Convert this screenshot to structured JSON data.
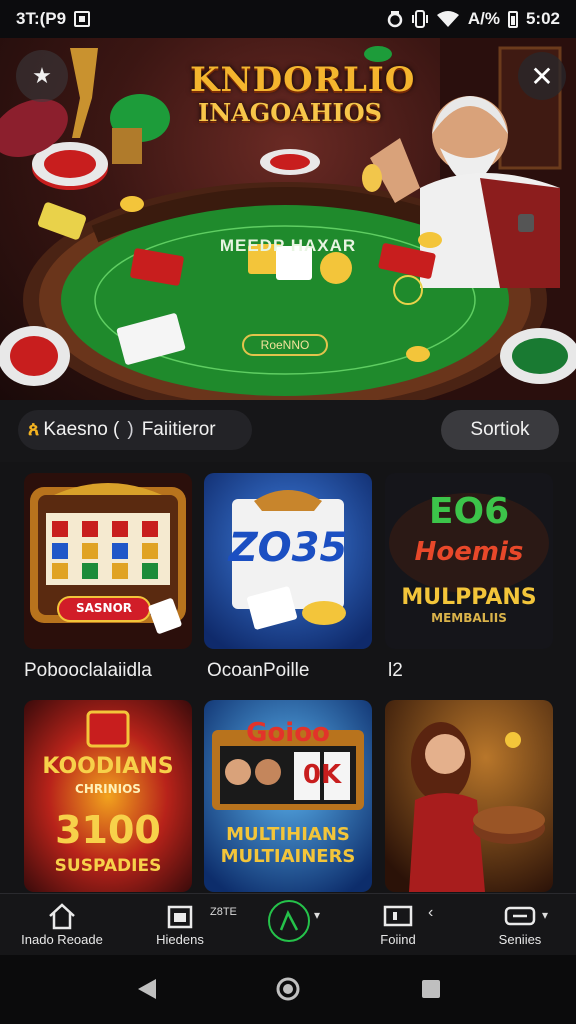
{
  "status_bar": {
    "time_left": "3T:(P9",
    "battery_text": "A/%",
    "clock": "5:02"
  },
  "hero": {
    "title_line1": "KNDORLIO",
    "title_line2": "INAGOAHIOS",
    "table_label": "MEEDP HAXAR",
    "table_button": "RoeNNO",
    "close_icon": "close-icon"
  },
  "filter": {
    "logo_glyph": "ጰ",
    "search_label": "Kaesno (",
    "search_sep": ")",
    "filter_label": "Faiitieror",
    "sort_label": "Sortiok"
  },
  "games": [
    {
      "caption": "Pobooclalaiidla",
      "button_text": "SASNOR"
    },
    {
      "caption": "OcoanPoille",
      "tile_text": "ZO35"
    },
    {
      "caption": "l2",
      "tile_text1": "ЕО6",
      "tile_text2": "Hoemis",
      "tile_text3": "MULPPANS",
      "tile_text4": "MEMBALIIS"
    },
    {
      "tile_text1": "KOODIANS",
      "tile_text2": "CHRINIOS",
      "tile_text3": "3100",
      "tile_text4": "SUSPADIES"
    },
    {
      "tile_text1": "Goioo",
      "tile_text2": "0K",
      "tile_text3": "MULTIHIANS",
      "tile_text4": "MULTIAINERS"
    },
    {
      "tile_text": ""
    }
  ],
  "bottom_nav": {
    "items": [
      {
        "label": "Inado Reoade",
        "icon": "home-icon"
      },
      {
        "label": "Hiedens",
        "icon": "calendar-icon"
      },
      {
        "label": "Foiind",
        "icon": "screen-icon"
      },
      {
        "label": "Seniies",
        "icon": "switch-icon"
      }
    ],
    "badge": "Z8TE",
    "center_icon": "lambda-icon"
  },
  "colors": {
    "accent_green": "#25c24a",
    "gold": "#f4b52e",
    "felt": "#1f8a2c"
  }
}
